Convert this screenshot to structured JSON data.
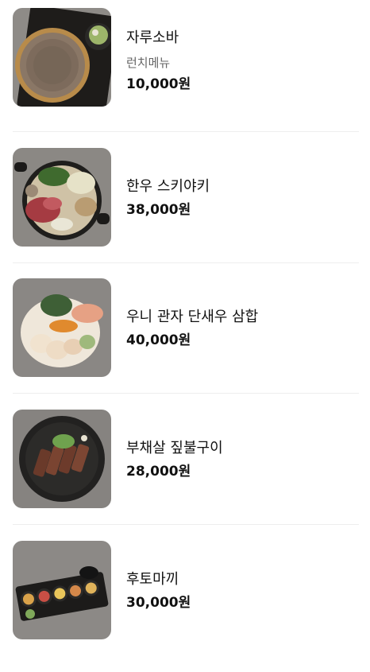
{
  "menu": [
    {
      "name": "자루소바",
      "subtitle": "런치메뉴",
      "price": "10,000원",
      "image": "zaru-soba-photo"
    },
    {
      "name": "한우 스키야키",
      "price": "38,000원",
      "image": "sukiyaki-photo"
    },
    {
      "name": "우니 관자 단새우 삼합",
      "price": "40,000원",
      "image": "sashimi-platter-photo"
    },
    {
      "name": "부채살 짚불구이",
      "price": "28,000원",
      "image": "grilled-beef-photo"
    },
    {
      "name": "후토마끼",
      "price": "30,000원",
      "image": "futomaki-photo"
    }
  ],
  "colors": {
    "text": "#111111",
    "subtext": "#666666",
    "divider": "#eeeeee",
    "photo_bg": "#8d8a86"
  }
}
